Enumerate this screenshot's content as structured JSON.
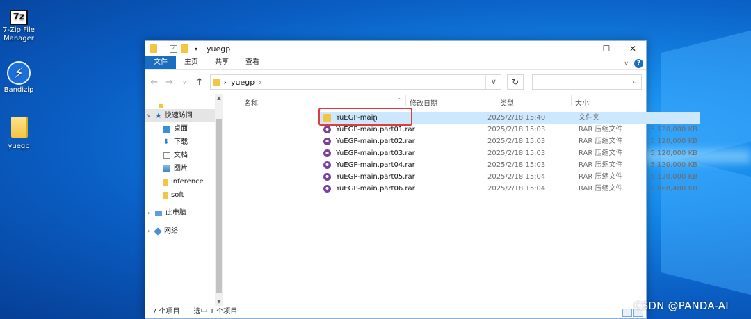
{
  "desktop": {
    "icons": [
      {
        "label_line1": "7-Zip File",
        "label_line2": "Manager",
        "glyph": "7z"
      },
      {
        "label": "Bandizip",
        "glyph": "⚡"
      },
      {
        "label": "yuegp"
      }
    ]
  },
  "window": {
    "title": "yuegp",
    "controls": {
      "minimize": "—",
      "maximize": "☐",
      "close": "✕"
    },
    "ribbon_tabs": [
      {
        "label": "文件",
        "active": true
      },
      {
        "label": "主页"
      },
      {
        "label": "共享"
      },
      {
        "label": "查看"
      }
    ],
    "address": {
      "path": "yuegp",
      "separator": "›"
    },
    "search_icon": "search-icon"
  },
  "nav_pane": {
    "quick_access": "快速访问",
    "items": [
      {
        "label": "桌面",
        "icon": "desktop-icon"
      },
      {
        "label": "下载",
        "icon": "download-icon"
      },
      {
        "label": "文档",
        "icon": "documents-icon"
      },
      {
        "label": "图片",
        "icon": "pictures-icon"
      },
      {
        "label": "inference",
        "icon": "folder-icon"
      },
      {
        "label": "soft",
        "icon": "folder-icon"
      }
    ],
    "this_pc": "此电脑",
    "network": "网络"
  },
  "columns": {
    "name": "名称",
    "date": "修改日期",
    "type": "类型",
    "size": "大小"
  },
  "files": [
    {
      "name": "YuEGP-main",
      "date": "2025/2/18 15:40",
      "type": "文件夹",
      "size": "",
      "kind": "folder",
      "selected": true
    },
    {
      "name": "YuEGP-main.part01.rar",
      "date": "2025/2/18 15:03",
      "type": "RAR 压缩文件",
      "size": "5,120,000 KB",
      "kind": "rar"
    },
    {
      "name": "YuEGP-main.part02.rar",
      "date": "2025/2/18 15:03",
      "type": "RAR 压缩文件",
      "size": "5,120,000 KB",
      "kind": "rar"
    },
    {
      "name": "YuEGP-main.part03.rar",
      "date": "2025/2/18 15:03",
      "type": "RAR 压缩文件",
      "size": "5,120,000 KB",
      "kind": "rar"
    },
    {
      "name": "YuEGP-main.part04.rar",
      "date": "2025/2/18 15:03",
      "type": "RAR 压缩文件",
      "size": "5,120,000 KB",
      "kind": "rar"
    },
    {
      "name": "YuEGP-main.part05.rar",
      "date": "2025/2/18 15:04",
      "type": "RAR 压缩文件",
      "size": "5,120,000 KB",
      "kind": "rar"
    },
    {
      "name": "YuEGP-main.part06.rar",
      "date": "2025/2/18 15:04",
      "type": "RAR 压缩文件",
      "size": "1,868,480 KB",
      "kind": "rar"
    }
  ],
  "status": {
    "count": "7 个项目",
    "selection": "选中 1 个项目"
  },
  "watermark": "CSDN @PANDA-AI",
  "colors": {
    "accent": "#1a6ec2",
    "selection": "#cce8ff",
    "highlight_box": "#e03c3c"
  }
}
